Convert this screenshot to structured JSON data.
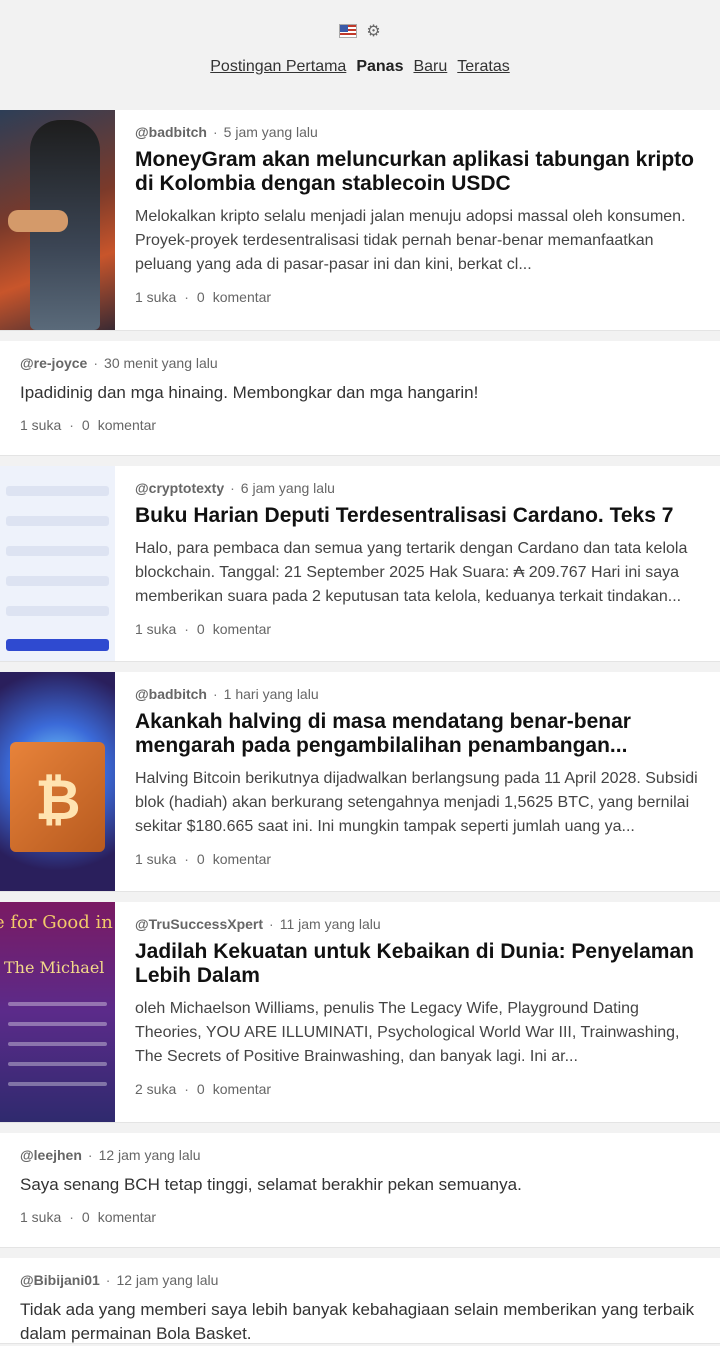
{
  "header": {
    "flag_icon": "us-flag-icon",
    "settings_icon": "gear-icon",
    "nav": [
      {
        "label": "Postingan Pertama",
        "active": false
      },
      {
        "label": "Panas",
        "active": true
      },
      {
        "label": "Baru",
        "active": false
      },
      {
        "label": "Teratas",
        "active": false
      }
    ]
  },
  "posts": [
    {
      "author": "@badbitch",
      "time": "5 jam yang lalu",
      "title": "MoneyGram akan meluncurkan aplikasi tabungan kripto di Kolombia dengan stablecoin USDC",
      "excerpt": "Melokalkan kripto selalu menjadi jalan menuju adopsi massal oleh konsumen. Proyek-proyek terdesentralisasi tidak pernah benar-benar memanfaatkan peluang yang ada di pasar-pasar ini dan kini, berkat cl...",
      "likes": "1 suka",
      "comments_count": "0",
      "comments_label": "komentar"
    },
    {
      "author": "@re-joyce",
      "time": "30 menit yang lalu",
      "text": "Ipadidinig dan mga hinaing. Membongkar dan mga hangarin!",
      "likes": "1 suka",
      "comments_count": "0",
      "comments_label": "komentar"
    },
    {
      "author": "@cryptotexty",
      "time": "6 jam yang lalu",
      "title": "Buku Harian Deputi Terdesentralisasi Cardano. Teks 7",
      "excerpt": "Halo, para pembaca dan semua yang tertarik dengan Cardano dan tata kelola blockchain. Tanggal: 21 September 2025 Hak Suara: ₳ 209.767 Hari ini saya memberikan suara pada 2 keputusan tata kelola, keduanya terkait tindakan...",
      "likes": "1 suka",
      "comments_count": "0",
      "comments_label": "komentar"
    },
    {
      "author": "@badbitch",
      "time": "1 hari yang lalu",
      "title": "Akankah halving di masa mendatang benar-benar mengarah pada pengambilalihan penambangan...",
      "excerpt": "Halving Bitcoin berikutnya dijadwalkan berlangsung pada 11 April 2028. Subsidi blok (hadiah) akan berkurang setengahnya menjadi 1,5625 BTC, yang bernilai sekitar $180.665 saat ini. Ini mungkin tampak seperti jumlah uang ya...",
      "likes": "1 suka",
      "comments_count": "0",
      "comments_label": "komentar"
    },
    {
      "author": "@TruSuccessXpert",
      "time": "11 jam yang lalu",
      "title": "Jadilah Kekuatan untuk Kebaikan di Dunia: Penyelaman Lebih Dalam",
      "excerpt": "oleh Michaelson Williams, penulis The Legacy Wife, Playground Dating Theories, YOU ARE ILLUMINATI, Psychological World War III, Trainwashing, The Secrets of Positive Brainwashing, dan banyak lagi. Ini ar...",
      "likes": "2 suka",
      "comments_count": "0",
      "comments_label": "komentar",
      "thumb_text_1": "e for Good in th",
      "thumb_text_2": "The Michael"
    },
    {
      "author": "@leejhen",
      "time": "12 jam yang lalu",
      "text": "Saya senang BCH tetap tinggi, selamat berakhir pekan semuanya.",
      "likes": "1 suka",
      "comments_count": "0",
      "comments_label": "komentar"
    },
    {
      "author": "@Bibijani01",
      "time": "12 jam yang lalu",
      "text": "Tidak ada yang memberi saya lebih banyak kebahagiaan selain memberikan yang terbaik dalam permainan Bola Basket."
    }
  ]
}
